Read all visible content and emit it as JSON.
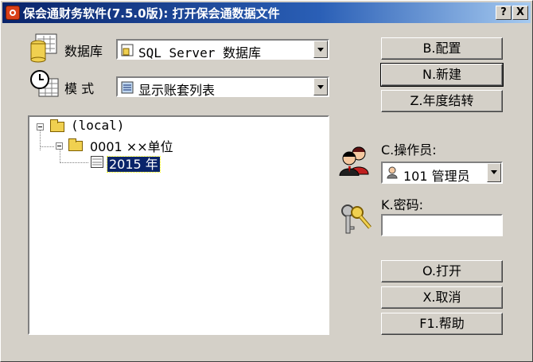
{
  "window": {
    "title": "保会通财务软件(7.5.0版): 打开保会通数据文件",
    "help_btn": "?",
    "close_btn": "X"
  },
  "labels": {
    "database": "数据库",
    "mode": "模 式",
    "operator": "C.操作员:",
    "password": "K.密码:"
  },
  "combos": {
    "database_value": "SQL Server 数据库",
    "mode_value": "显示账套列表",
    "operator_value": "101 管理员"
  },
  "tree": {
    "root": "(local)",
    "unit": "0001 ××单位",
    "year": "2015 年"
  },
  "buttons": {
    "config": "B.配置",
    "new": "N.新建",
    "year_end": "Z.年度结转",
    "open": "O.打开",
    "cancel": "X.取消",
    "help": "F1.帮助"
  },
  "password_value": ""
}
